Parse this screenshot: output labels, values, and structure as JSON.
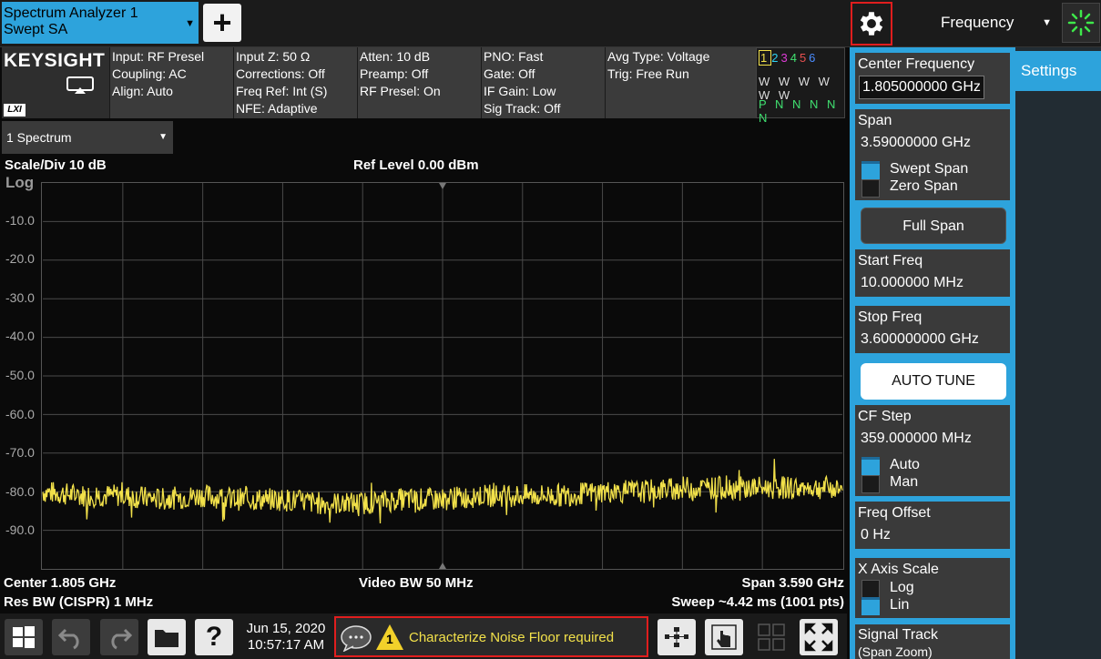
{
  "topbar": {
    "app_line1": "Spectrum Analyzer 1",
    "app_line2": "Swept SA",
    "add_label": "+",
    "menu_title": "Frequency"
  },
  "info": {
    "logo": "KEYSIGHT",
    "lxi": "LXI",
    "col1": [
      "Input: RF Presel",
      "Coupling: AC",
      "Align: Auto"
    ],
    "col2": [
      "Input Z: 50 Ω",
      "Corrections: Off",
      "Freq Ref: Int (S)",
      "NFE: Adaptive"
    ],
    "col3": [
      "Atten: 10 dB",
      "Preamp: Off",
      "RF Presel: On"
    ],
    "col4": [
      "PNO: Fast",
      "Gate: Off",
      "IF Gain: Low",
      "Sig Track: Off"
    ],
    "col5": [
      "Avg Type: Voltage",
      "Trig: Free Run"
    ],
    "traces": {
      "numbers": [
        "1",
        "2",
        "3",
        "4",
        "5",
        "6"
      ],
      "colors": [
        "#f2e14a",
        "#2fd4f2",
        "#e03bd8",
        "#40e070",
        "#e85050",
        "#4a8cff"
      ],
      "row2": "W W W W W W",
      "row3": "P N N N N N"
    }
  },
  "screen": {
    "window_select": "1 Spectrum",
    "scale": "Scale/Div 10 dB",
    "ref_level": "Ref Level 0.00 dBm",
    "log_label": "Log",
    "ylabels": [
      "-10.0",
      "-20.0",
      "-30.0",
      "-40.0",
      "-50.0",
      "-60.0",
      "-70.0",
      "-80.0",
      "-90.0"
    ],
    "center": "Center 1.805 GHz",
    "video_bw": "Video BW 50 MHz",
    "span": "Span 3.590 GHz",
    "res_bw": "Res BW  (CISPR) 1 MHz",
    "sweep": "Sweep ~4.42 ms  (1001 pts)",
    "trace_color": "#f2e14a"
  },
  "chart_data": {
    "type": "line",
    "title": "",
    "xlabel": "",
    "ylabel": "",
    "ylim": [
      -100,
      0
    ],
    "xlim": [
      10,
      3600
    ],
    "x_unit": "MHz",
    "y_unit": "dBm",
    "grid": true,
    "series": [
      {
        "x": [
          10,
          180,
          360,
          540,
          720,
          900,
          1080,
          1260,
          1440,
          1620,
          1800,
          1980,
          2160,
          2340,
          2520,
          2700,
          2880,
          3060,
          3240,
          3420,
          3600
        ],
        "values": [
          -80,
          -81,
          -81,
          -82,
          -81,
          -82,
          -82,
          -83,
          -83,
          -82,
          -82,
          -81,
          -81,
          -81,
          -80,
          -80,
          -79,
          -79,
          -79,
          -79,
          -79
        ]
      }
    ]
  },
  "bottombar": {
    "date": "Jun 15, 2020",
    "time": "10:57:17 AM",
    "msg_count": "1",
    "message": "Characterize Noise Floor required"
  },
  "panel": {
    "side_tab": "Settings",
    "center_freq_title": "Center Frequency",
    "center_freq_value": "1.805000000 GHz",
    "span_title": "Span",
    "span_value": "3.59000000 GHz",
    "swept_span": "Swept Span",
    "zero_span": "Zero Span",
    "full_span": "Full Span",
    "start_title": "Start Freq",
    "start_value": "10.000000 MHz",
    "stop_title": "Stop Freq",
    "stop_value": "3.600000000 GHz",
    "auto_tune": "AUTO TUNE",
    "cf_step_title": "CF Step",
    "cf_step_value": "359.000000 MHz",
    "auto": "Auto",
    "man": "Man",
    "freq_offset_title": "Freq Offset",
    "freq_offset_value": "0 Hz",
    "x_axis_title": "X Axis Scale",
    "log": "Log",
    "lin": "Lin",
    "signal_track_title": "Signal Track",
    "signal_track_sub": "(Span Zoom)"
  }
}
